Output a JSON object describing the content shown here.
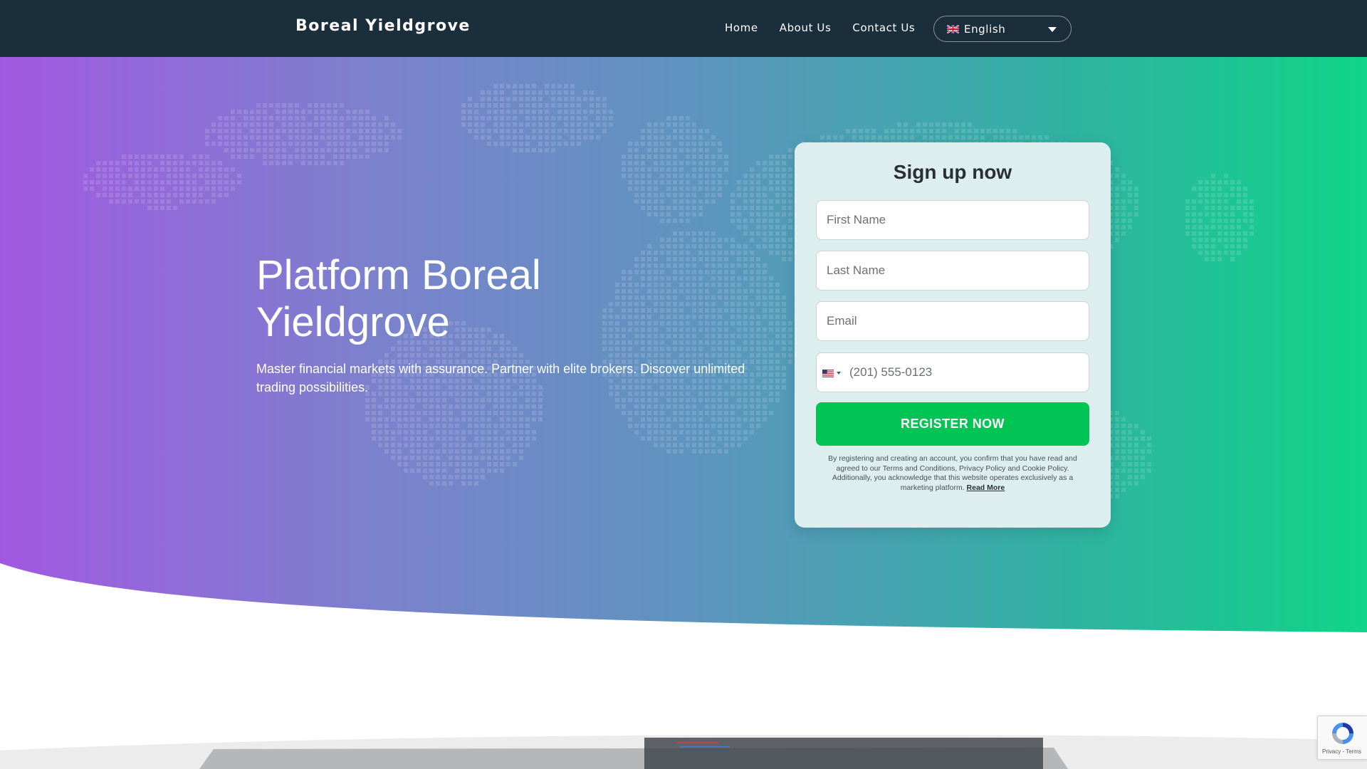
{
  "header": {
    "brand": "Boreal Yieldgrove",
    "nav": [
      "Home",
      "About Us",
      "Contact Us"
    ],
    "language": "English"
  },
  "hero": {
    "title": "Platform Boreal Yieldgrove",
    "subtitle": "Master financial markets with assurance. Partner with elite brokers. Discover unlimited trading possibilities."
  },
  "form": {
    "title": "Sign up now",
    "first_name_placeholder": "First Name",
    "last_name_placeholder": "Last Name",
    "email_placeholder": "Email",
    "phone_placeholder": "(201) 555-0123",
    "register_label": "REGISTER NOW",
    "legal_text": "By registering and creating an account, you confirm that you have read and agreed to our Terms and Conditions, Privacy Policy and Cookie Policy. Additionally, you acknowledge that this website operates exclusively as a marketing platform.",
    "read_more": "Read More"
  },
  "recaptcha": {
    "links": "Privacy - Terms"
  },
  "colors": {
    "header_bg": "#1b2e3c",
    "gradient_start": "#a259e2",
    "gradient_end": "#10d488",
    "register_button": "#00c454",
    "card_bg": "#dcefee"
  }
}
